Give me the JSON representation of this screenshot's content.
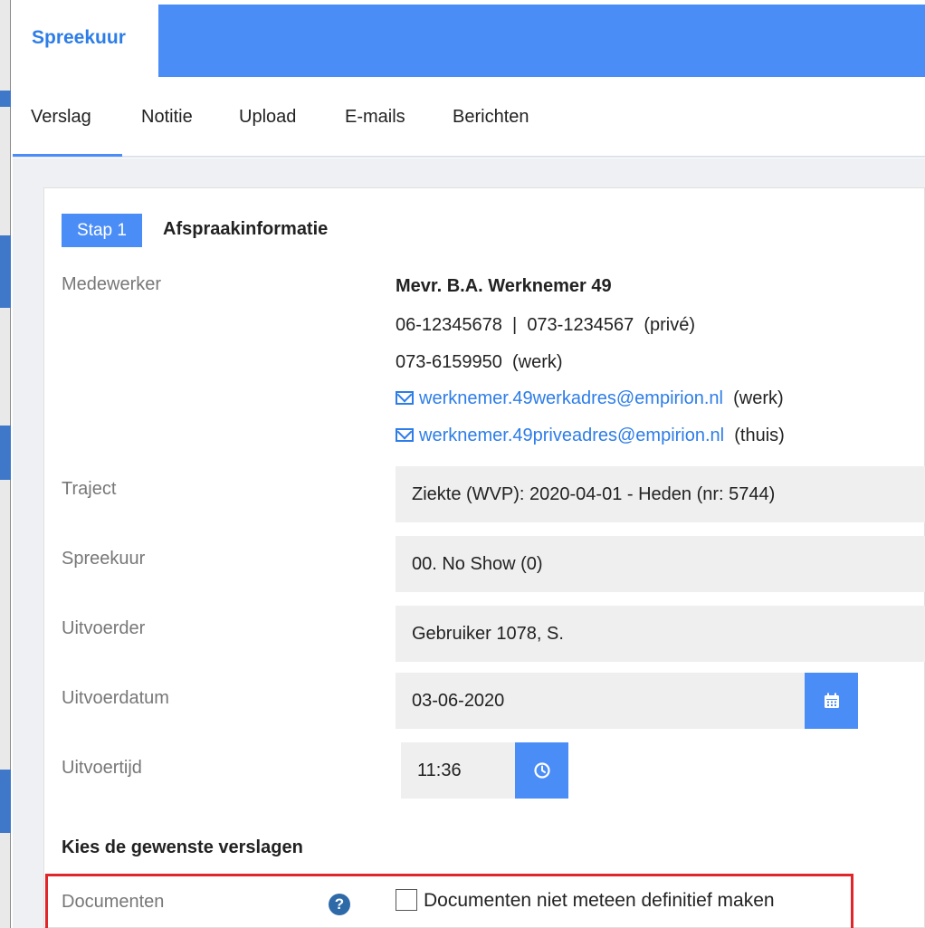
{
  "header": {
    "title": "Spreekuur"
  },
  "tabs": [
    {
      "label": "Verslag"
    },
    {
      "label": "Notitie"
    },
    {
      "label": "Upload"
    },
    {
      "label": "E-mails"
    },
    {
      "label": "Berichten"
    }
  ],
  "step": {
    "badge": "Stap 1",
    "title": "Afspraakinformatie"
  },
  "employee": {
    "label": "Medewerker",
    "name": "Mevr. B.A. Werknemer 49",
    "phone_line": "06-12345678  |  073-1234567  (privé)",
    "work_phone": "073-6159950  (werk)",
    "email_work": "werknemer.49werkadres@empirion.nl",
    "email_work_tag": "(werk)",
    "email_home": "werknemer.49priveadres@empirion.nl",
    "email_home_tag": "(thuis)"
  },
  "fields": {
    "traject": {
      "label": "Traject",
      "value": "Ziekte (WVP): 2020-04-01 - Heden (nr: 5744)"
    },
    "spreekuur": {
      "label": "Spreekuur",
      "value": "00. No Show (0)"
    },
    "uitvoerder": {
      "label": "Uitvoerder",
      "value": "Gebruiker 1078, S."
    },
    "uitvoerdatum": {
      "label": "Uitvoerdatum",
      "value": "03-06-2020"
    },
    "uitvoertijd": {
      "label": "Uitvoertijd",
      "value": "11:36"
    }
  },
  "reports": {
    "section_title": "Kies de gewenste verslagen",
    "documents_label": "Documenten",
    "help_glyph": "?",
    "checkbox_label": "Documenten niet meteen definitief maken"
  },
  "colors": {
    "accent": "#4b8df6",
    "link": "#2d7de8",
    "highlight": "#e0262a"
  }
}
